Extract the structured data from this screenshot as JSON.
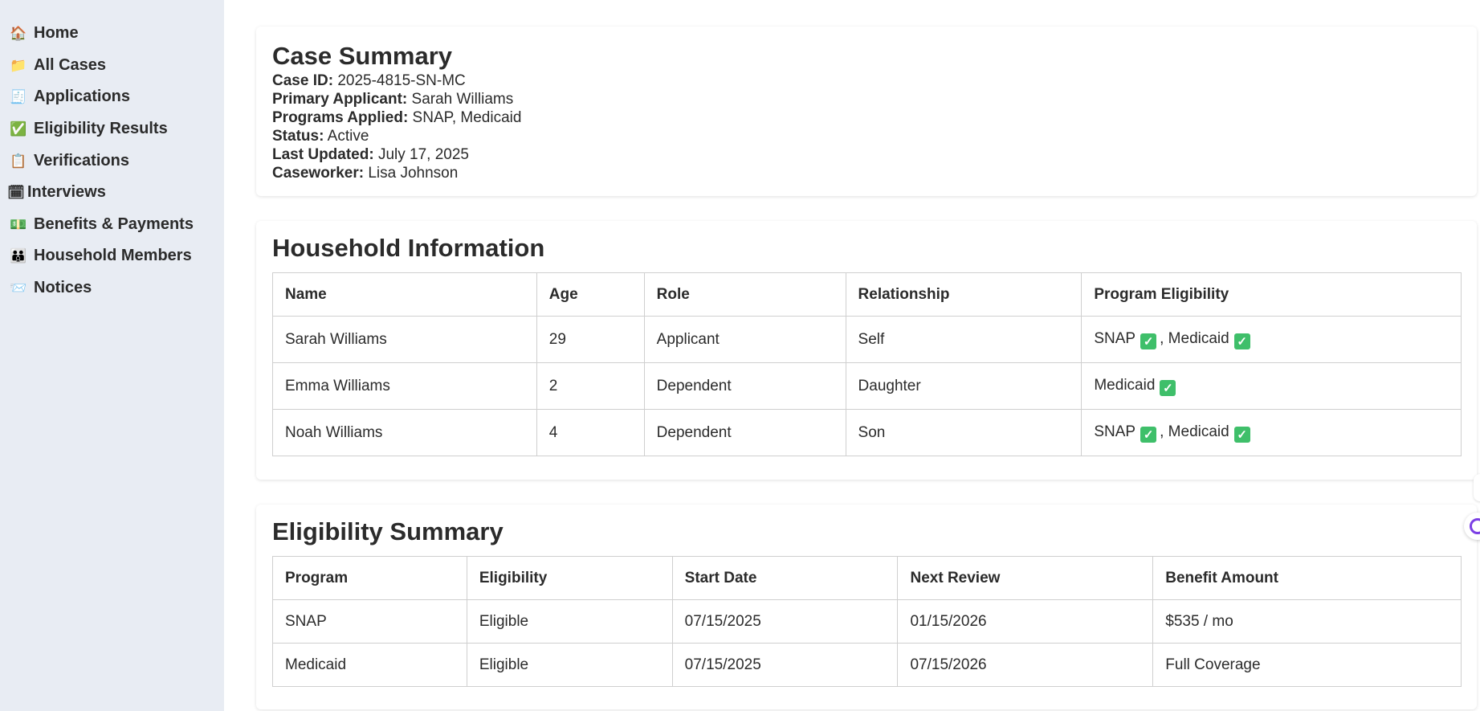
{
  "sidebar": {
    "items": [
      {
        "label": "Home",
        "icon": "🏠"
      },
      {
        "label": "All Cases",
        "icon": "📁"
      },
      {
        "label": "Applications",
        "icon": "🧾"
      },
      {
        "label": "Eligibility Results",
        "icon": "✅"
      },
      {
        "label": "Verifications",
        "icon": "📋"
      },
      {
        "label": "Interviews",
        "icon": "🗓"
      },
      {
        "label": "Benefits & Payments",
        "icon": "💵"
      },
      {
        "label": "Household Members",
        "icon": "👪"
      },
      {
        "label": "Notices",
        "icon": "📨"
      }
    ]
  },
  "case_summary": {
    "title": "Case Summary",
    "case_id_label": "Case ID:",
    "case_id": "2025-4815-SN-MC",
    "applicant_label": "Primary Applicant:",
    "applicant": "Sarah Williams",
    "programs_label": "Programs Applied:",
    "programs": "SNAP, Medicaid",
    "status_label": "Status:",
    "status": "Active",
    "updated_label": "Last Updated:",
    "updated": "July 17, 2025",
    "caseworker_label": "Caseworker:",
    "caseworker": "Lisa Johnson"
  },
  "household": {
    "title": "Household Information",
    "headers": [
      "Name",
      "Age",
      "Role",
      "Relationship",
      "Program Eligibility"
    ],
    "rows": [
      {
        "name": "Sarah Williams",
        "age": "29",
        "role": "Applicant",
        "relationship": "Self",
        "programs": [
          "SNAP",
          "Medicaid"
        ]
      },
      {
        "name": "Emma Williams",
        "age": "2",
        "role": "Dependent",
        "relationship": "Daughter",
        "programs": [
          "Medicaid"
        ]
      },
      {
        "name": "Noah Williams",
        "age": "4",
        "role": "Dependent",
        "relationship": "Son",
        "programs": [
          "SNAP",
          "Medicaid"
        ]
      }
    ]
  },
  "eligibility": {
    "title": "Eligibility Summary",
    "headers": [
      "Program",
      "Eligibility",
      "Start Date",
      "Next Review",
      "Benefit Amount"
    ],
    "rows": [
      {
        "program": "SNAP",
        "eligibility": "Eligible",
        "start": "07/15/2025",
        "review": "01/15/2026",
        "amount": "$535 / mo"
      },
      {
        "program": "Medicaid",
        "eligibility": "Eligible",
        "start": "07/15/2025",
        "review": "07/15/2026",
        "amount": "Full Coverage"
      }
    ]
  },
  "colors": {
    "sidebar_bg": "#e8ecf3",
    "check_green": "#3fbf6a",
    "widget_purple": "#7b3fe4"
  }
}
